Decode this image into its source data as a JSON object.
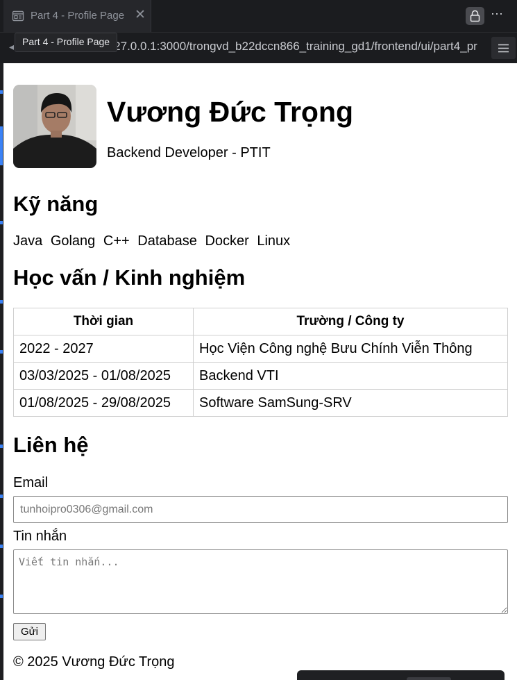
{
  "editor": {
    "tab_title": "Part 4 - Profile Page",
    "tooltip": "Part 4 - Profile Page",
    "url": "/127.0.0.1:3000/trongvd_b22dccn866_training_gd1/frontend/ui/part4_pr"
  },
  "profile": {
    "name": "Vương Đức Trọng",
    "role": "Backend Developer - PTIT"
  },
  "skills": {
    "heading": "Kỹ năng",
    "items": [
      "Java",
      "Golang",
      "C++",
      "Database",
      "Docker",
      "Linux"
    ]
  },
  "education": {
    "heading": "Học vấn / Kinh nghiệm",
    "columns": [
      "Thời gian",
      "Trường / Công ty"
    ],
    "rows": [
      [
        "2022 - 2027",
        "Học Viện Công nghệ Bưu Chính Viễn Thông"
      ],
      [
        "03/03/2025 - 01/08/2025",
        "Backend VTI"
      ],
      [
        "01/08/2025 - 29/08/2025",
        "Software SamSung-SRV"
      ]
    ]
  },
  "contact": {
    "heading": "Liên hệ",
    "email_label": "Email",
    "email_placeholder": "tunhoipro0306@gmail.com",
    "message_label": "Tin nhắn",
    "message_placeholder": "Viết tin nhắn...",
    "send_label": "Gửi"
  },
  "footer": {
    "text": "© 2025 Vương Đức Trọng"
  }
}
